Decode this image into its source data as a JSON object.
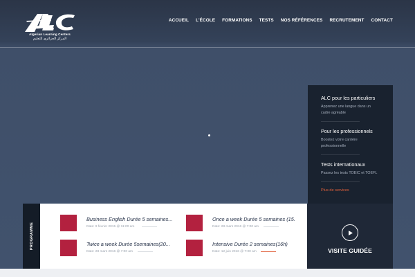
{
  "logo": {
    "name": "Algerian Learning Centers",
    "arabic": "المركز الجزائري للتعليم",
    "letters": "ALC"
  },
  "nav": {
    "items": [
      "ACCUEIL",
      "L'ÉCOLE",
      "FORMATIONS",
      "TESTS",
      "NOS RÉFÉRENCES",
      "RECRUTEMENT",
      "CONTACT"
    ]
  },
  "side_panel": {
    "items": [
      {
        "title": "ALC pour les particuliers",
        "desc": "Apprenez une langue dans un cadre agréable"
      },
      {
        "title": "Pour les professionnels",
        "desc": "Boostez votre carrière professionnelle"
      },
      {
        "title": "Tests internationaux",
        "desc": "Passez les tests TOEIC et TOEFL"
      }
    ],
    "more": "Plus de services"
  },
  "programme": {
    "label": "PROGRAMME",
    "courses": [
      {
        "title": "Business English Durée 5 semaines...",
        "meta": "Date: 9 février 2015 @ 11:00 am",
        "progress": 0.3
      },
      {
        "title": "Once a week Durée 5 semaines (15.",
        "meta": "Date: 28 mars 2016 @ 7:00 am",
        "progress": 0.3
      },
      {
        "title": "Twice a week Durée 5semaines(20...",
        "meta": "Date: 28 mars 2016 @ 7:00 am",
        "progress": 0.3
      },
      {
        "title": "Intensive Durée 2 semaines(16h)",
        "meta": "Date: 12 juin 2016 @ 7:00 am",
        "progress": 0.3
      }
    ]
  },
  "visite": {
    "label": "VISITE GUIDÉE",
    "icon": "play-icon"
  },
  "colors": {
    "accent": "#e0603b",
    "course_thumb": "#b3213f",
    "panel": "#19222f",
    "hero": "#3e4e67"
  }
}
